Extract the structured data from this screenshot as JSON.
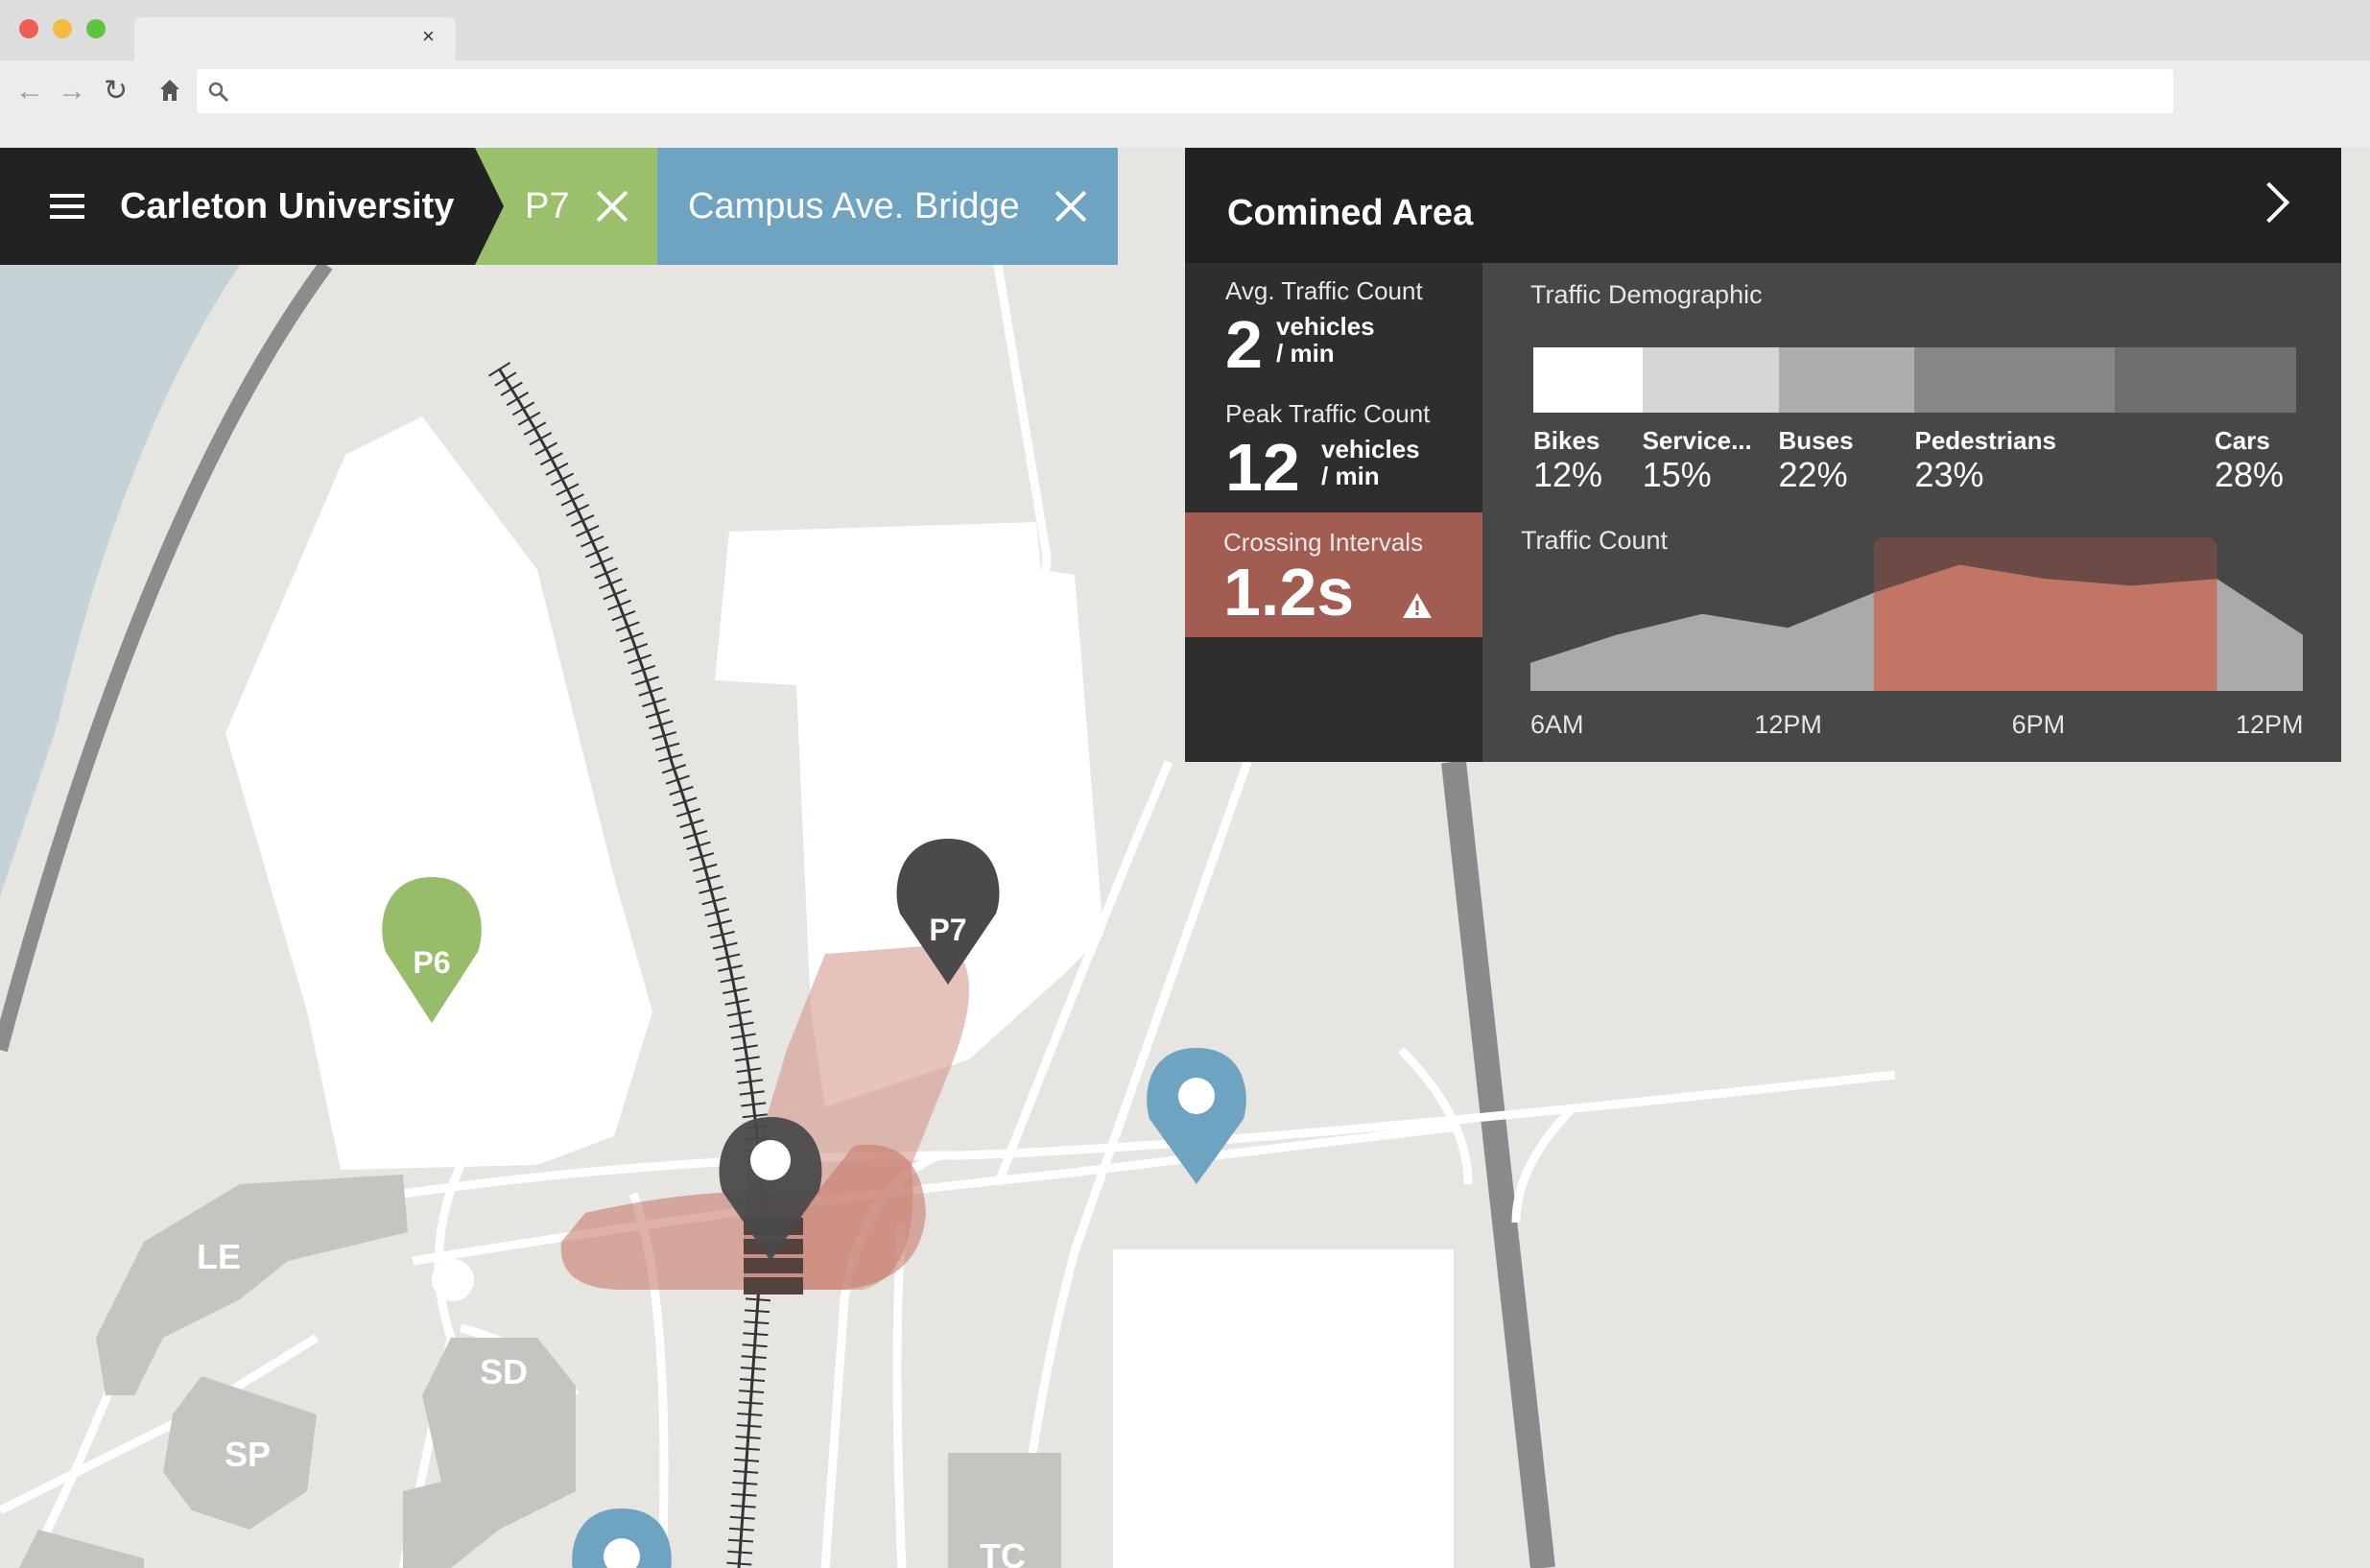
{
  "browser": {
    "tab_close": "×",
    "colors": {
      "close": "#ec5f55",
      "minimize": "#f3bb3f",
      "maximize": "#5fc240"
    },
    "nav_icons": [
      "back-arrow-icon",
      "forward-arrow-icon",
      "reload-icon",
      "home-icon",
      "search-icon"
    ]
  },
  "topbar": {
    "title": "Carleton University",
    "chips": [
      {
        "label": "P7",
        "color": "#9ac06b"
      },
      {
        "label": "Campus Ave. Bridge",
        "color": "#6fa3c2"
      }
    ]
  },
  "map": {
    "pins": [
      {
        "label": "P6",
        "color": "#97bd6a"
      },
      {
        "label": "P7",
        "color": "#4a4a4a"
      }
    ],
    "buildings": [
      "LE",
      "SD",
      "SP",
      "TC"
    ]
  },
  "panel": {
    "title": "Comined Area",
    "stats": [
      {
        "label": "Avg. Traffic Count",
        "value": "2",
        "unit_line1": "vehicles",
        "unit_line2": "/ min"
      },
      {
        "label": "Peak Traffic Count",
        "value": "12",
        "unit_line1": "vehicles",
        "unit_line2": "/ min"
      }
    ],
    "alert": {
      "label": "Crossing Intervals",
      "value": "1.2s",
      "color": "#a35c52"
    },
    "demographic": {
      "title": "Traffic Demographic",
      "segments": [
        {
          "name": "Bikes",
          "pct": "12%",
          "share": 0.12,
          "color": "#ffffff"
        },
        {
          "name": "Service...",
          "pct": "15%",
          "share": 0.15,
          "color": "#d6d6d6"
        },
        {
          "name": "Buses",
          "pct": "22%",
          "share": 0.15,
          "color": "#aeaeae"
        },
        {
          "name": "Pedestrians",
          "pct": "23%",
          "share": 0.22,
          "color": "#878787"
        },
        {
          "name": "Cars",
          "pct": "28%",
          "share": 0.2,
          "color": "#6f6f6f"
        }
      ]
    }
  },
  "chart_data": {
    "type": "area",
    "title": "Traffic Count",
    "x": [
      "6AM",
      "",
      "",
      "12PM",
      "",
      "",
      "6PM",
      "",
      "",
      "12PM"
    ],
    "series": [
      {
        "values": [
          2,
          4,
          5.5,
          4.5,
          7,
          9,
          8,
          7.5,
          8,
          4
        ]
      }
    ],
    "xticks": [
      "6AM",
      "12PM",
      "6PM",
      "12PM"
    ],
    "highlight_range": [
      4,
      8
    ],
    "colors": {
      "area": "#aaaaaa",
      "highlight": "#c27565",
      "highlight_bg": "#6c4a45"
    }
  }
}
